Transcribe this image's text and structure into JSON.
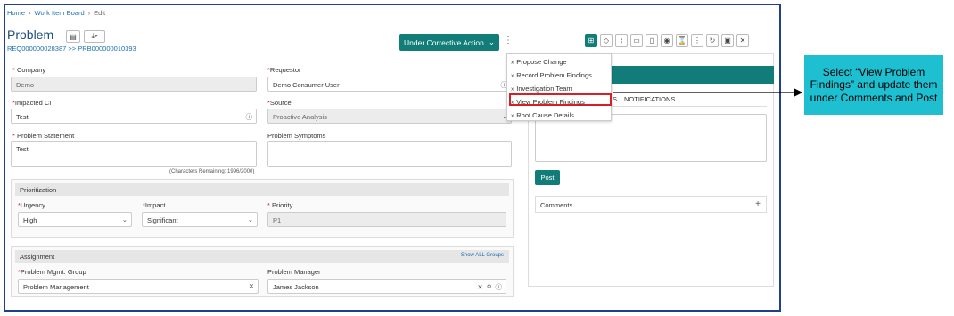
{
  "breadcrumb": [
    "Home",
    "Work Item Board",
    "Edit"
  ],
  "title": "Problem",
  "ticket_ref": "REQ000000028387 >> PRB000000010393",
  "status_button": "Under Corrective Action",
  "form": {
    "company": {
      "label": "Company",
      "value": "Demo"
    },
    "requestor": {
      "label": "Requestor",
      "value": "Demo Consumer User"
    },
    "impacted_ci": {
      "label": "Impacted CI",
      "value": "Test"
    },
    "source": {
      "label": "Source",
      "value": "Proactive Analysis"
    },
    "problem_statement": {
      "label": "Problem Statement",
      "value": "Test",
      "hint": "(Characters Remaining: 1996/2000)"
    },
    "problem_symptoms": {
      "label": "Problem Symptoms",
      "value": ""
    }
  },
  "prioritization": {
    "title": "Prioritization",
    "urgency": {
      "label": "Urgency",
      "value": "High"
    },
    "impact": {
      "label": "Impact",
      "value": "Significant"
    },
    "priority": {
      "label": "Priority",
      "value": "P1"
    }
  },
  "assignment": {
    "title": "Assignment",
    "show_all": "Show ALL Groups",
    "group": {
      "label": "Problem Mgmt. Group",
      "value": "Problem Management"
    },
    "manager": {
      "label": "Problem Manager",
      "value": "James Jackson"
    }
  },
  "menu": {
    "items": [
      "» Propose Change",
      "» Record Problem Findings",
      "» Investigation Team",
      "» View Problem Findings",
      "» Root Cause Details"
    ]
  },
  "right_panel": {
    "tab_notifications": "NOTIFICATIONS",
    "tab_partial": "S",
    "post_label": "Post",
    "comments_label": "Comments",
    "comments_toggle": "+"
  },
  "callout": "Select “View Problem Findings” and update them under Comments and Post",
  "colors": {
    "accent": "#127d78",
    "callout": "#1dbfd0",
    "highlight": "#d91f26",
    "frame": "#1f3f8f"
  }
}
